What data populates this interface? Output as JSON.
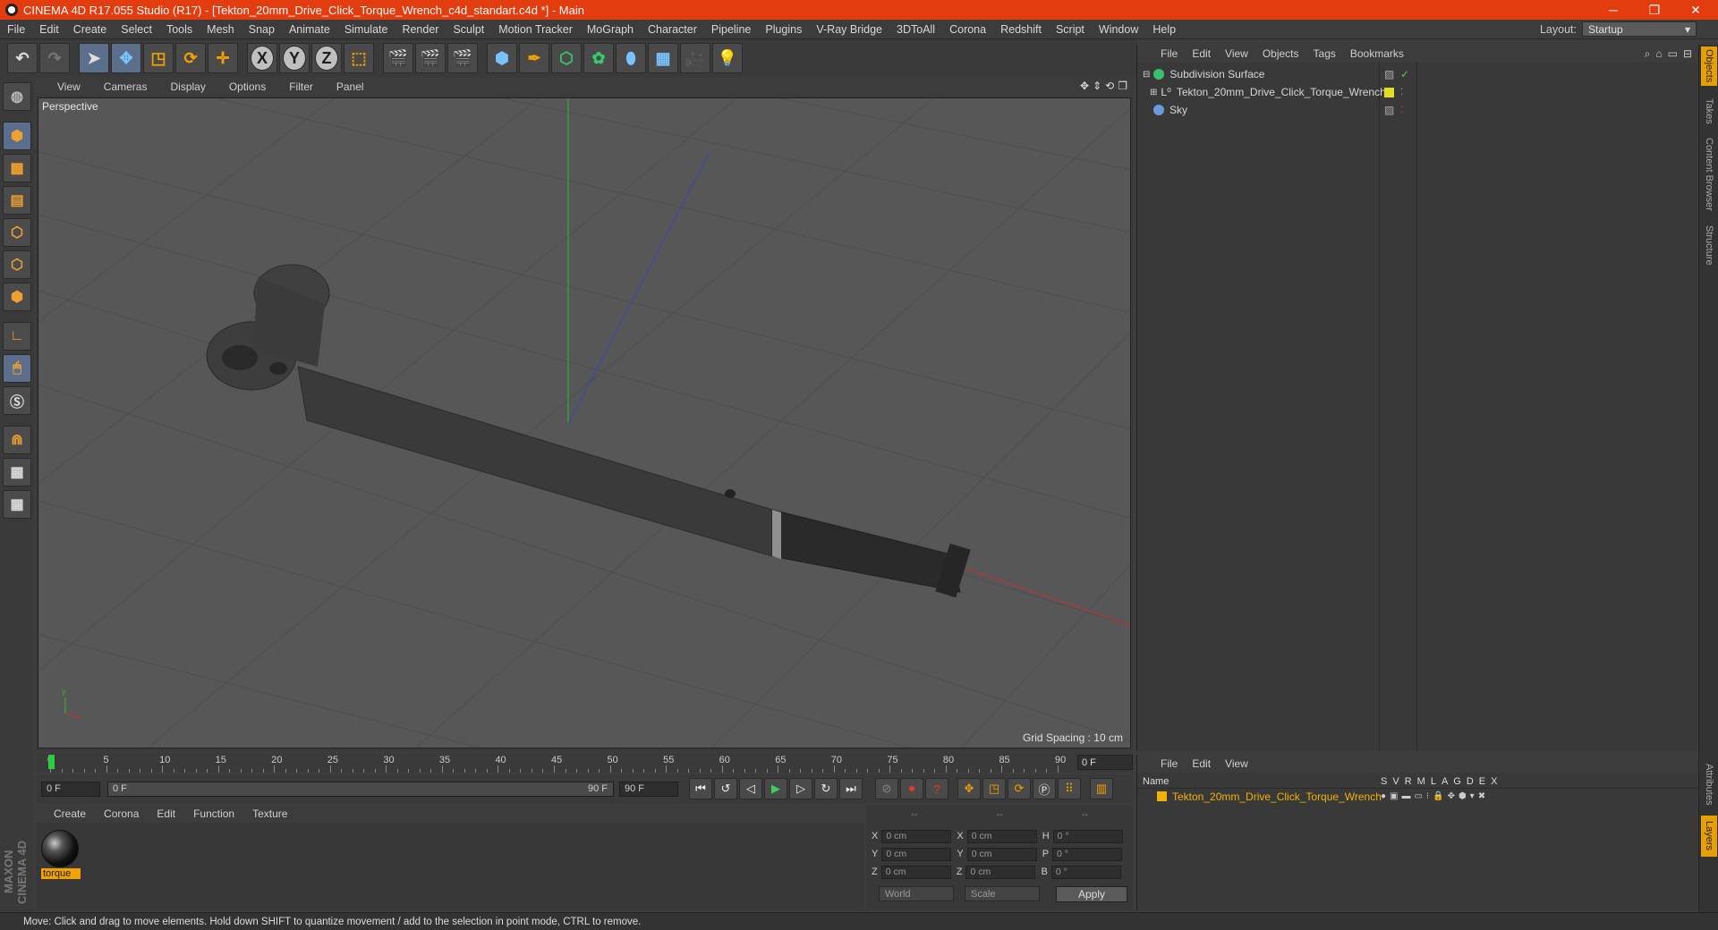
{
  "window": {
    "title": "CINEMA 4D R17.055 Studio (R17) - [Tekton_20mm_Drive_Click_Torque_Wrench_c4d_standart.c4d *] - Main",
    "minimize": "─",
    "maximize": "❐",
    "close": "✕"
  },
  "menubar": {
    "items": [
      "File",
      "Edit",
      "Create",
      "Select",
      "Tools",
      "Mesh",
      "Snap",
      "Animate",
      "Simulate",
      "Render",
      "Sculpt",
      "Motion Tracker",
      "MoGraph",
      "Character",
      "Pipeline",
      "Plugins",
      "V-Ray Bridge",
      "3DToAll",
      "Corona",
      "Redshift",
      "Script",
      "Window",
      "Help"
    ],
    "layout_label": "Layout:",
    "layout_value": "Startup"
  },
  "viewport": {
    "menu": [
      "View",
      "Cameras",
      "Display",
      "Options",
      "Filter",
      "Panel"
    ],
    "label": "Perspective",
    "grid_spacing": "Grid Spacing : 10 cm"
  },
  "timeline": {
    "ticks": [
      "0",
      "5",
      "10",
      "15",
      "20",
      "25",
      "30",
      "35",
      "40",
      "45",
      "50",
      "55",
      "60",
      "65",
      "70",
      "75",
      "80",
      "85",
      "90"
    ],
    "current_frame": "0 F",
    "start": "0 F",
    "range_start": "0 F",
    "range_end": "90 F",
    "end": "90 F"
  },
  "material_panel": {
    "menu": [
      "Create",
      "Corona",
      "Edit",
      "Function",
      "Texture"
    ],
    "material_name": "torque"
  },
  "coordinates": {
    "headers": [
      "--",
      "--",
      "--"
    ],
    "rows": [
      {
        "a": "X",
        "av": "0 cm",
        "b": "X",
        "bv": "0 cm",
        "c": "H",
        "cv": "0 °"
      },
      {
        "a": "Y",
        "av": "0 cm",
        "b": "Y",
        "bv": "0 cm",
        "c": "P",
        "cv": "0 °"
      },
      {
        "a": "Z",
        "av": "0 cm",
        "b": "Z",
        "bv": "0 cm",
        "c": "B",
        "cv": "0 °"
      }
    ],
    "mode1": "World",
    "mode2": "Scale",
    "apply": "Apply"
  },
  "object_manager": {
    "menu": [
      "File",
      "Edit",
      "View",
      "Objects",
      "Tags",
      "Bookmarks"
    ],
    "objects": [
      {
        "name": "Subdivision Surface",
        "color": "#38c070"
      },
      {
        "name": "Tekton_20mm_Drive_Click_Torque_Wrench",
        "color": "#e0e020"
      },
      {
        "name": "Sky",
        "color": "#6a9be0"
      }
    ]
  },
  "layer_manager": {
    "menu": [
      "File",
      "Edit",
      "View"
    ],
    "name_header": "Name",
    "flags": [
      "S",
      "V",
      "R",
      "M",
      "L",
      "A",
      "G",
      "D",
      "E",
      "X"
    ],
    "layer_name": "Tekton_20mm_Drive_Click_Torque_Wrench"
  },
  "right_tabs": [
    "Objects",
    "Takes",
    "Content Browser",
    "Structure",
    "Attributes",
    "Layers"
  ],
  "branding": "MAXON CINEMA 4D",
  "status": "Move: Click and drag to move elements. Hold down SHIFT to quantize movement / add to the selection in point mode, CTRL to remove."
}
